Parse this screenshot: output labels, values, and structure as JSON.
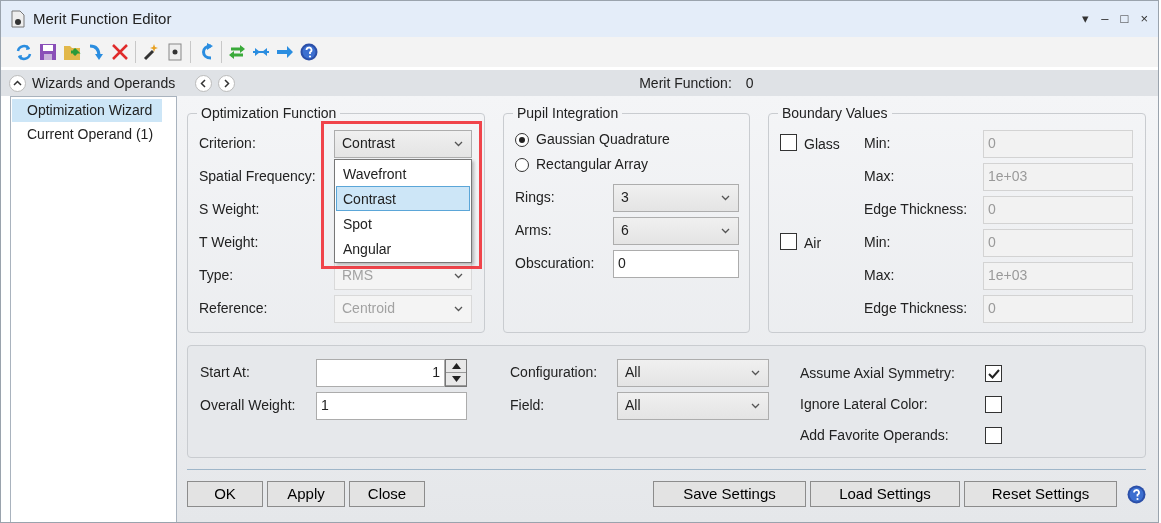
{
  "window": {
    "title": "Merit Function Editor",
    "controls": [
      "▾",
      "–",
      "□",
      "×"
    ]
  },
  "header": {
    "title": "Wizards and Operands",
    "merit_label": "Merit Function:",
    "merit_value": "0"
  },
  "sidebar": {
    "items": [
      {
        "label": "Optimization Wizard",
        "selected": true
      },
      {
        "label": "Current Operand (1)",
        "selected": false
      }
    ]
  },
  "optimization_function": {
    "title": "Optimization Function",
    "rows": [
      {
        "label": "Criterion:",
        "kind": "select",
        "value": "Contrast",
        "disabled": false,
        "open": true,
        "options": [
          {
            "label": "Wavefront",
            "selected": false
          },
          {
            "label": "Contrast",
            "selected": true
          },
          {
            "label": "Spot",
            "selected": false
          },
          {
            "label": "Angular",
            "selected": false
          }
        ]
      },
      {
        "label": "Spatial Frequency:",
        "kind": "covered"
      },
      {
        "label": "S Weight:",
        "kind": "covered"
      },
      {
        "label": "T Weight:",
        "kind": "covered"
      },
      {
        "label": "Type:",
        "kind": "select",
        "value": "RMS",
        "disabled": true,
        "open": false
      },
      {
        "label": "Reference:",
        "kind": "select",
        "value": "Centroid",
        "disabled": true,
        "open": false
      }
    ]
  },
  "pupil_integration": {
    "title": "Pupil Integration",
    "radios": [
      {
        "label": "Gaussian Quadrature",
        "selected": true
      },
      {
        "label": "Rectangular Array",
        "selected": false
      }
    ],
    "rows": [
      {
        "label": "Rings:",
        "kind": "select",
        "value": "3",
        "disabled": false,
        "open": false
      },
      {
        "label": "Arms:",
        "kind": "select",
        "value": "6",
        "disabled": false,
        "open": false
      },
      {
        "label": "Obscuration:",
        "kind": "input",
        "value": "0",
        "disabled": false
      }
    ]
  },
  "boundary_values": {
    "title": "Boundary Values",
    "groups": [
      {
        "label": "Glass",
        "checked": false,
        "fields": [
          {
            "label": "Min:",
            "value": "0",
            "disabled": true
          },
          {
            "label": "Max:",
            "value": "1e+03",
            "disabled": true
          },
          {
            "label": "Edge Thickness:",
            "value": "0",
            "disabled": true
          }
        ]
      },
      {
        "label": "Air",
        "checked": false,
        "fields": [
          {
            "label": "Min:",
            "value": "0",
            "disabled": true
          },
          {
            "label": "Max:",
            "value": "1e+03",
            "disabled": true
          },
          {
            "label": "Edge Thickness:",
            "value": "0",
            "disabled": true
          }
        ]
      }
    ]
  },
  "settings": {
    "start_at": {
      "label": "Start At:",
      "value": "1"
    },
    "overall_weight": {
      "label": "Overall Weight:",
      "value": "1"
    },
    "selects": [
      {
        "label": "Configuration:",
        "value": "All"
      },
      {
        "label": "Field:",
        "value": "All"
      }
    ],
    "checks": [
      {
        "label": "Assume Axial Symmetry:",
        "checked": true
      },
      {
        "label": "Ignore Lateral Color:",
        "checked": false
      },
      {
        "label": "Add Favorite Operands:",
        "checked": false
      }
    ]
  },
  "buttons_left": [
    "OK",
    "Apply",
    "Close"
  ],
  "buttons_right": [
    "Save Settings",
    "Load Settings",
    "Reset Settings"
  ]
}
